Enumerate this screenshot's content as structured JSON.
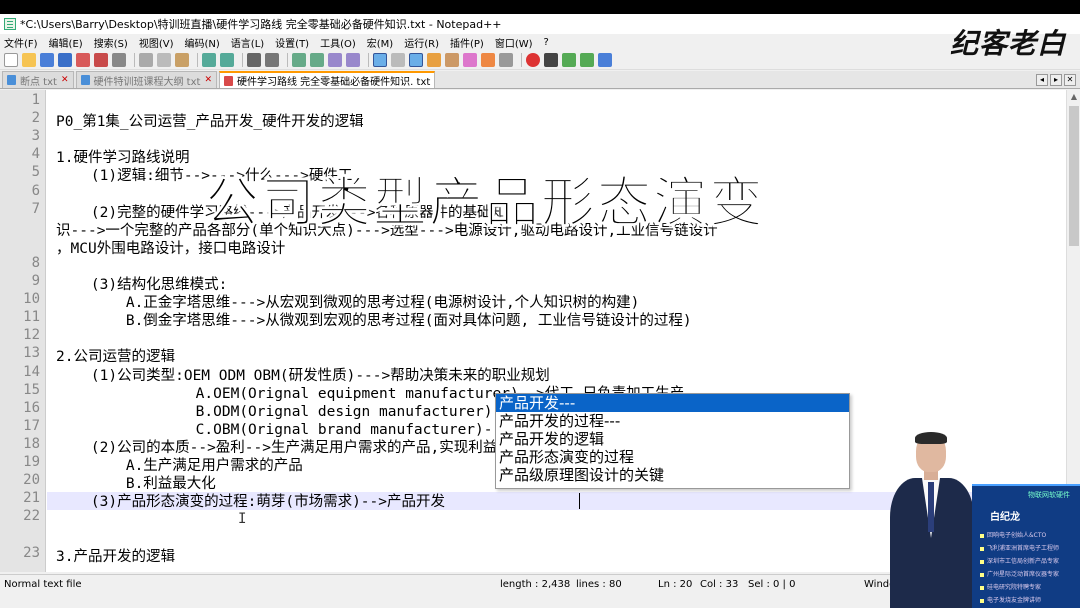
{
  "window": {
    "title": "*C:\\Users\\Barry\\Desktop\\特训班直播\\硬件学习路线  完全零基础必备硬件知识.txt - Notepad++"
  },
  "logo": {
    "text": "纪客老白"
  },
  "menu": [
    "文件(F)",
    "编辑(E)",
    "搜索(S)",
    "视图(V)",
    "编码(N)",
    "语言(L)",
    "设置(T)",
    "工具(O)",
    "宏(M)",
    "运行(R)",
    "插件(P)",
    "窗口(W)",
    "?"
  ],
  "tabs": [
    {
      "label": "断点 txt",
      "active": false
    },
    {
      "label": "硬件特训班课程大纲 txt",
      "active": false
    },
    {
      "label": "硬件学习路线  完全零基础必备硬件知识. txt",
      "active": true
    }
  ],
  "editor": {
    "line_numbers": [
      "1",
      "2",
      "3",
      "4",
      "5",
      "6",
      "7",
      "8",
      "9",
      "10",
      "11",
      "12",
      "13",
      "14",
      "15",
      "16",
      "17",
      "18",
      "19",
      "20",
      "21",
      "22",
      "23"
    ],
    "lines": [
      "",
      "P0_第1集_公司运营_产品开发_硬件开发的逻辑",
      "",
      "1.硬件学习路线说明",
      "    (1)逻辑:细节-->--->什么--->硬件工",
      "",
      "    (2)完整的硬件学习路线--->产品开发--->各种原器件的基础知",
      "识--->一个完整的产品各部分(单个知识大点)--->选型--->电源设计,驱动电路设计,工业信号链设计",
      "，MCU外围电路设计，接口电路设计",
      "",
      "    (3)结构化思维模式:",
      "        A.正金字塔思维--->从宏观到微观的思考过程(电源树设计,个人知识树的构建)",
      "        B.倒金字塔思维--->从微观到宏观的思考过程(面对具体问题, 工业信号链设计的过程)",
      "",
      "2.公司运营的逻辑",
      "    (1)公司类型:OEM ODM OBM(研发性质)--->帮助决策未来的职业规划",
      "                A.OEM(Orignal equipment manufacturer)-->代工,只负责加工生产",
      "                B.ODM(Orignal design manufacturer)-->设计与加工",
      "                C.OBM(Orignal brand manufacturer)-->研发,设计,加工和销售",
      "    (2)公司的本质-->盈利-->生产满足用户需求的产品,实现利益最大化",
      "        A.生产满足用户需求的产品",
      "        B.利益最大化",
      "    (3)产品形态演变的过程:萌芽(市场需求)-->产品开发",
      "",
      "",
      "3.产品开发的逻辑"
    ]
  },
  "autocomplete": [
    "产品开发---",
    "产品开发的过程---",
    "产品开发的逻辑",
    "产品形态演变的过程",
    "产品级原理图设计的关键"
  ],
  "overlay_caption": "公司类型产品形态演变",
  "status": {
    "type": "Normal text file",
    "length": "length : 2,438",
    "lines": "lines : 80",
    "ln": "Ln : 20",
    "col": "Col : 33",
    "sel": "Sel : 0 | 0",
    "eol": "Window"
  },
  "presenter_card": {
    "name": "白纪龙",
    "tag": "物联网软硬件",
    "items": [
      "回响电子创始人&CTO",
      "飞利浦亚洲首席电子工程师",
      "深圳市工信局创新产品专家",
      "广州星际泛动首席仪器专家",
      "硅电研究院特聘专家",
      "电子发烧友金牌讲师"
    ]
  },
  "colors": {
    "active_tab_accent": "#ff9900",
    "current_line": "#e8e8ff",
    "autocomplete_selected": "#0a64c8",
    "card_bg": "#103c84"
  }
}
